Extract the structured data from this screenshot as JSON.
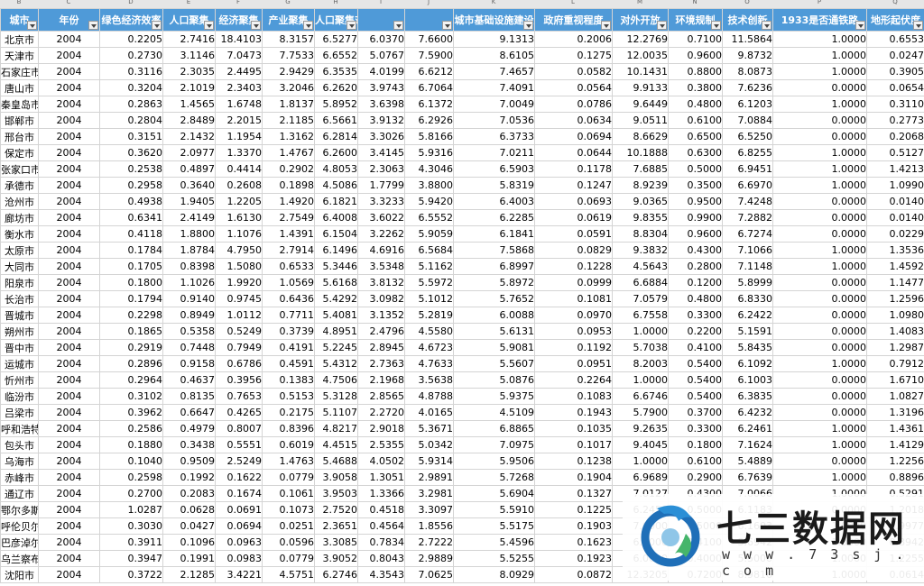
{
  "columns": [
    "B",
    "C",
    "D",
    "E",
    "F",
    "G",
    "H",
    "I",
    "J",
    "K",
    "L",
    "M",
    "N",
    "O",
    "P",
    "Q"
  ],
  "headers": [
    "城市",
    "年份",
    "绿色经济效率",
    "人口聚集",
    "经济聚集",
    "产业聚集",
    "人口聚集对经济聚集对产业聚集对",
    "",
    "",
    "城市基础设施建设",
    "政府重视程度",
    "对外开放",
    "环境规制",
    "技术创新",
    "1933是否通铁路",
    "地形起伏度"
  ],
  "rows": [
    [
      "北京市",
      "2004",
      "0.2205",
      "2.7416",
      "18.4103",
      "8.3157",
      "6.5277",
      "6.0370",
      "7.6600",
      "9.1313",
      "0.2006",
      "12.2769",
      "0.7100",
      "11.5864",
      "1.0000",
      "0.6553"
    ],
    [
      "天津市",
      "2004",
      "0.2730",
      "3.1146",
      "7.0473",
      "7.7533",
      "6.6552",
      "5.0767",
      "7.5900",
      "8.6105",
      "0.1275",
      "12.0035",
      "0.9600",
      "9.8732",
      "1.0000",
      "0.0247"
    ],
    [
      "石家庄市",
      "2004",
      "0.3116",
      "2.3035",
      "2.4495",
      "2.9429",
      "6.3535",
      "4.0199",
      "6.6212",
      "7.4657",
      "0.0582",
      "10.1431",
      "0.8800",
      "8.0873",
      "1.0000",
      "0.3905"
    ],
    [
      "唐山市",
      "2004",
      "0.3204",
      "2.1019",
      "2.3403",
      "3.2046",
      "6.2620",
      "3.9743",
      "6.7064",
      "7.4091",
      "0.0564",
      "9.9133",
      "0.3800",
      "7.6236",
      "0.0000",
      "0.0654"
    ],
    [
      "秦皇岛市",
      "2004",
      "0.2863",
      "1.4565",
      "1.6748",
      "1.8137",
      "5.8952",
      "3.6398",
      "6.1372",
      "7.0049",
      "0.0786",
      "9.6449",
      "0.4800",
      "6.1203",
      "1.0000",
      "0.3110"
    ],
    [
      "邯郸市",
      "2004",
      "0.2804",
      "2.8489",
      "2.2015",
      "2.1185",
      "6.5661",
      "3.9132",
      "6.2926",
      "7.0536",
      "0.0634",
      "9.0511",
      "0.6100",
      "7.0884",
      "0.0000",
      "0.2773"
    ],
    [
      "邢台市",
      "2004",
      "0.3151",
      "2.1432",
      "1.1954",
      "1.3162",
      "6.2814",
      "3.3026",
      "5.8166",
      "6.3733",
      "0.0694",
      "8.6629",
      "0.6500",
      "6.5250",
      "0.0000",
      "0.2068"
    ],
    [
      "保定市",
      "2004",
      "0.3620",
      "2.0977",
      "1.3370",
      "1.4767",
      "6.2600",
      "3.4145",
      "5.9316",
      "7.0211",
      "0.0644",
      "10.1888",
      "0.6300",
      "6.8255",
      "1.0000",
      "0.5127"
    ],
    [
      "张家口市",
      "2004",
      "0.2538",
      "0.4897",
      "0.4414",
      "0.2902",
      "4.8053",
      "2.3063",
      "4.3046",
      "6.5903",
      "0.1178",
      "7.6885",
      "0.5000",
      "6.9451",
      "1.0000",
      "1.4213"
    ],
    [
      "承德市",
      "2004",
      "0.2958",
      "0.3640",
      "0.2608",
      "0.1898",
      "4.5086",
      "1.7799",
      "3.8800",
      "5.8319",
      "0.1247",
      "8.9239",
      "0.3500",
      "6.6970",
      "1.0000",
      "1.0990"
    ],
    [
      "沧州市",
      "2004",
      "0.4938",
      "1.9405",
      "1.2205",
      "1.4920",
      "6.1821",
      "3.3233",
      "5.9420",
      "6.4003",
      "0.0693",
      "9.0365",
      "0.9500",
      "7.4248",
      "0.0000",
      "0.0140"
    ],
    [
      "廊坊市",
      "2004",
      "0.6341",
      "2.4149",
      "1.6130",
      "2.7549",
      "6.4008",
      "3.6022",
      "6.5552",
      "6.2285",
      "0.0619",
      "9.8355",
      "0.9900",
      "7.2882",
      "0.0000",
      "0.0140"
    ],
    [
      "衡水市",
      "2004",
      "0.4118",
      "1.8800",
      "1.1076",
      "1.4391",
      "6.1504",
      "3.2262",
      "5.9059",
      "6.1841",
      "0.0591",
      "8.8304",
      "0.9600",
      "6.7274",
      "0.0000",
      "0.0229"
    ],
    [
      "太原市",
      "2004",
      "0.1784",
      "1.8784",
      "4.7950",
      "2.7914",
      "6.1496",
      "4.6916",
      "6.5684",
      "7.5868",
      "0.0829",
      "9.3832",
      "0.4300",
      "7.1066",
      "1.0000",
      "1.3536"
    ],
    [
      "大同市",
      "2004",
      "0.1705",
      "0.8398",
      "1.5080",
      "0.6533",
      "5.3446",
      "3.5348",
      "5.1162",
      "6.8997",
      "0.1228",
      "4.5643",
      "0.2800",
      "7.1148",
      "1.0000",
      "1.4592"
    ],
    [
      "阳泉市",
      "2004",
      "0.1800",
      "1.1026",
      "1.9920",
      "1.0569",
      "5.6168",
      "3.8132",
      "5.5972",
      "5.8972",
      "0.0999",
      "6.6884",
      "0.1200",
      "5.8999",
      "0.0000",
      "1.1477"
    ],
    [
      "长治市",
      "2004",
      "0.1794",
      "0.9140",
      "0.9745",
      "0.6436",
      "5.4292",
      "3.0982",
      "5.1012",
      "5.7652",
      "0.1081",
      "7.0579",
      "0.4800",
      "6.8330",
      "0.0000",
      "1.2596"
    ],
    [
      "晋城市",
      "2004",
      "0.2298",
      "0.8949",
      "1.0112",
      "0.7711",
      "5.4081",
      "3.1352",
      "5.2819",
      "6.0088",
      "0.0970",
      "6.7558",
      "0.3300",
      "6.2422",
      "0.0000",
      "1.0980"
    ],
    [
      "朔州市",
      "2004",
      "0.1865",
      "0.5358",
      "0.5249",
      "0.3739",
      "4.8951",
      "2.4796",
      "4.5580",
      "5.6131",
      "0.0953",
      "1.0000",
      "0.2200",
      "5.1591",
      "0.0000",
      "1.4083"
    ],
    [
      "晋中市",
      "2004",
      "0.2919",
      "0.7448",
      "0.7949",
      "0.4191",
      "5.2245",
      "2.8945",
      "4.6723",
      "5.9081",
      "0.1192",
      "5.7038",
      "0.4100",
      "5.8435",
      "0.0000",
      "1.2987"
    ],
    [
      "运城市",
      "2004",
      "0.2896",
      "0.9158",
      "0.6786",
      "0.4591",
      "5.4312",
      "2.7363",
      "4.7633",
      "5.5607",
      "0.0951",
      "8.2003",
      "0.5400",
      "6.1092",
      "1.0000",
      "0.7912"
    ],
    [
      "忻州市",
      "2004",
      "0.2964",
      "0.4637",
      "0.3956",
      "0.1383",
      "4.7506",
      "2.1968",
      "3.5638",
      "5.0876",
      "0.2264",
      "1.0000",
      "0.5400",
      "6.1003",
      "0.0000",
      "1.6710"
    ],
    [
      "临汾市",
      "2004",
      "0.3102",
      "0.8135",
      "0.7653",
      "0.5153",
      "5.3128",
      "2.8565",
      "4.8788",
      "5.9375",
      "0.1083",
      "6.6746",
      "0.5400",
      "6.3835",
      "0.0000",
      "1.0827"
    ],
    [
      "吕梁市",
      "2004",
      "0.3962",
      "0.6647",
      "0.4265",
      "0.2175",
      "5.1107",
      "2.2720",
      "4.0165",
      "4.5109",
      "0.1943",
      "5.7900",
      "0.3700",
      "6.4232",
      "0.0000",
      "1.3196"
    ],
    [
      "呼和浩特市",
      "2004",
      "0.2586",
      "0.4979",
      "0.8007",
      "0.8396",
      "4.8217",
      "2.9018",
      "5.3671",
      "6.8865",
      "0.1035",
      "9.2635",
      "0.3300",
      "6.2461",
      "1.0000",
      "1.4361"
    ],
    [
      "包头市",
      "2004",
      "0.1880",
      "0.3438",
      "0.5551",
      "0.6019",
      "4.4515",
      "2.5355",
      "5.0342",
      "7.0975",
      "0.1017",
      "9.4045",
      "0.1800",
      "7.1624",
      "1.0000",
      "1.4129"
    ],
    [
      "乌海市",
      "2004",
      "0.1040",
      "0.9509",
      "2.5249",
      "1.4763",
      "5.4688",
      "4.0502",
      "5.9314",
      "5.9506",
      "0.1238",
      "1.0000",
      "0.6100",
      "5.4889",
      "0.0000",
      "1.2256"
    ],
    [
      "赤峰市",
      "2004",
      "0.2598",
      "0.1992",
      "0.1622",
      "0.0779",
      "3.9058",
      "1.3051",
      "2.9891",
      "5.7268",
      "0.1904",
      "6.9689",
      "0.2900",
      "6.7639",
      "1.0000",
      "0.8896"
    ],
    [
      "通辽市",
      "2004",
      "0.2700",
      "0.2083",
      "0.1674",
      "0.1061",
      "3.9503",
      "1.3366",
      "3.2981",
      "5.6904",
      "0.1327",
      "7.0127",
      "0.4300",
      "7.0066",
      "1.0000",
      "0.5291"
    ],
    [
      "鄂尔多斯市",
      "2004",
      "1.0287",
      "0.0628",
      "0.0691",
      "0.1073",
      "2.7520",
      "0.4518",
      "3.3097",
      "5.5910",
      "0.1225",
      "6.2450",
      "0.5000",
      "6.1183",
      "0.0000",
      "1.2018"
    ],
    [
      "呼伦贝尔市",
      "2004",
      "0.3030",
      "0.0427",
      "0.0694",
      "0.0251",
      "2.3651",
      "0.4564",
      "1.8556",
      "5.5175",
      "0.1903",
      "7.0000",
      "0.5000",
      "6.1603",
      "1.0000",
      "0.9977"
    ],
    [
      "巴彦淖尔市",
      "2004",
      "0.3911",
      "0.1096",
      "0.0963",
      "0.0596",
      "3.3085",
      "0.7834",
      "2.7222",
      "5.4596",
      "0.1623",
      "6.0000",
      "0.4100",
      "5.6942",
      "1.0000",
      "0.8942"
    ],
    [
      "乌兰察布市",
      "2004",
      "0.3947",
      "0.1991",
      "0.0983",
      "0.0779",
      "3.9052",
      "0.8043",
      "2.9889",
      "5.5255",
      "0.1923",
      "6.0000",
      "0.4000",
      "5.5000",
      "1.0000",
      "1.2255"
    ],
    [
      "沈阳市",
      "2004",
      "0.3722",
      "2.1285",
      "3.4221",
      "4.5751",
      "6.2746",
      "4.3543",
      "7.0625",
      "8.0929",
      "0.0872",
      "12.3205",
      "0.7200",
      "8.9816",
      "1.0000",
      "0.0614"
    ]
  ],
  "watermark": {
    "title": "七三数据网",
    "url": "w w w . 7 3 s j . c o m"
  }
}
